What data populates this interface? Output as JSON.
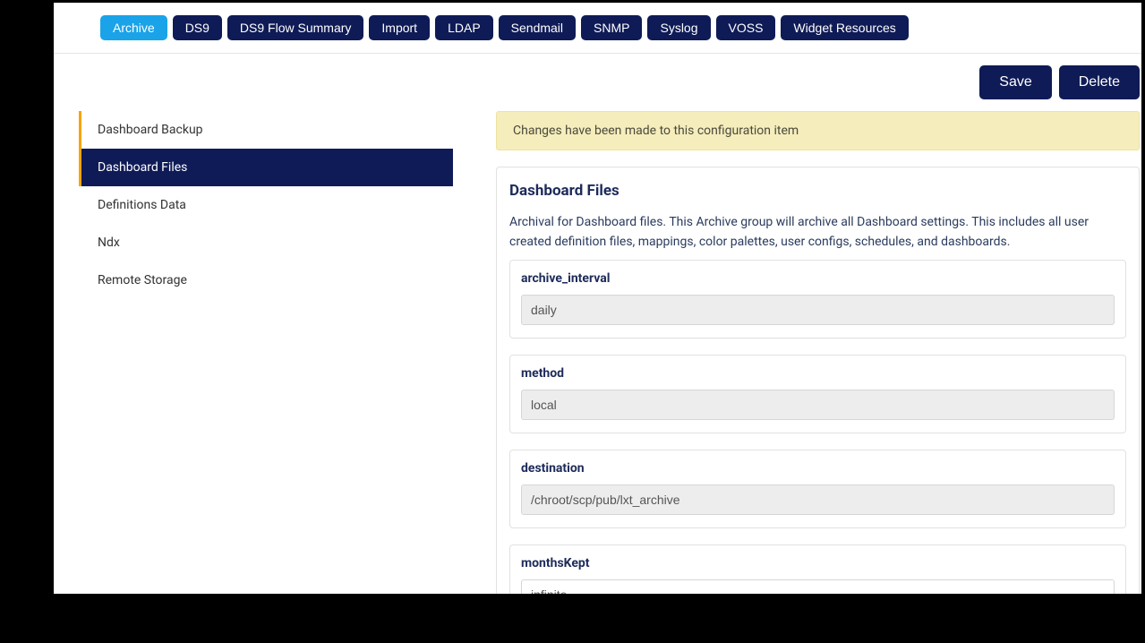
{
  "tabs": {
    "archive": "Archive",
    "ds9": "DS9",
    "ds9_flow_summary": "DS9 Flow Summary",
    "import": "Import",
    "ldap": "LDAP",
    "sendmail": "Sendmail",
    "snmp": "SNMP",
    "syslog": "Syslog",
    "voss": "VOSS",
    "widget_resources": "Widget Resources"
  },
  "actions": {
    "save": "Save",
    "delete": "Delete"
  },
  "sidebar": {
    "dashboard_backup": "Dashboard Backup",
    "dashboard_files": "Dashboard Files",
    "definitions_data": "Definitions Data",
    "ndx": "Ndx",
    "remote_storage": "Remote Storage"
  },
  "alert": "Changes have been made to this configuration item",
  "panel": {
    "title": "Dashboard Files",
    "description": "Archival for Dashboard files. This Archive group will archive all Dashboard settings. This includes all user created definition files, mappings, color palettes, user configs, schedules, and dashboards.",
    "fields": {
      "archive_interval": {
        "label": "archive_interval",
        "value": "daily"
      },
      "method": {
        "label": "method",
        "value": "local"
      },
      "destination": {
        "label": "destination",
        "value": "/chroot/scp/pub/lxt_archive"
      },
      "months_kept": {
        "label": "monthsKept",
        "value": "infinite"
      }
    }
  }
}
